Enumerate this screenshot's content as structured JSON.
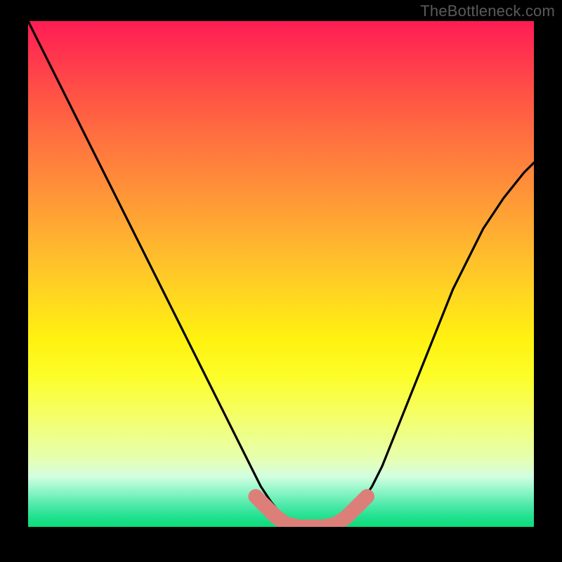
{
  "watermark": "TheBottleneck.com",
  "colors": {
    "frame": "#000000",
    "curve": "#000000",
    "marker_fill": "#dd7f79",
    "gradient_top": "#ff1c55",
    "gradient_mid": "#ffe817",
    "gradient_bottom": "#0cdc79"
  },
  "chart_data": {
    "type": "line",
    "title": "",
    "xlabel": "",
    "ylabel": "",
    "xlim": [
      0,
      100
    ],
    "ylim": [
      0,
      100
    ],
    "grid": false,
    "legend_position": "none",
    "series": [
      {
        "name": "bottleneck-curve",
        "x": [
          0,
          2,
          4,
          6,
          8,
          10,
          12,
          14,
          16,
          18,
          20,
          22,
          24,
          26,
          28,
          30,
          32,
          34,
          36,
          38,
          40,
          42,
          44,
          46,
          48,
          50,
          52,
          54,
          56,
          58,
          60,
          62,
          64,
          66,
          68,
          70,
          72,
          74,
          76,
          78,
          80,
          82,
          84,
          86,
          88,
          90,
          92,
          94,
          96,
          98,
          100
        ],
        "y": [
          100,
          96,
          92,
          88,
          84,
          80,
          76,
          72,
          68,
          64,
          60,
          56,
          52,
          48,
          44,
          40,
          36,
          32,
          28,
          24,
          20,
          16,
          12,
          8,
          5,
          2.5,
          1,
          0,
          0,
          0,
          0.5,
          1.5,
          3,
          5,
          8,
          12,
          17,
          22,
          27,
          32,
          37,
          42,
          47,
          51,
          55,
          59,
          62,
          65,
          67.5,
          70,
          72
        ]
      }
    ],
    "markers": {
      "name": "optimal-range",
      "style": "pink-rounded-segments",
      "points": [
        {
          "x": 45,
          "y": 6
        },
        {
          "x": 47,
          "y": 4
        },
        {
          "x": 49,
          "y": 2
        },
        {
          "x": 51,
          "y": 0.6
        },
        {
          "x": 53.5,
          "y": 0
        },
        {
          "x": 56,
          "y": 0
        },
        {
          "x": 58.5,
          "y": 0
        },
        {
          "x": 61,
          "y": 0.6
        },
        {
          "x": 63,
          "y": 2
        },
        {
          "x": 65,
          "y": 4
        },
        {
          "x": 67,
          "y": 6
        }
      ]
    }
  }
}
